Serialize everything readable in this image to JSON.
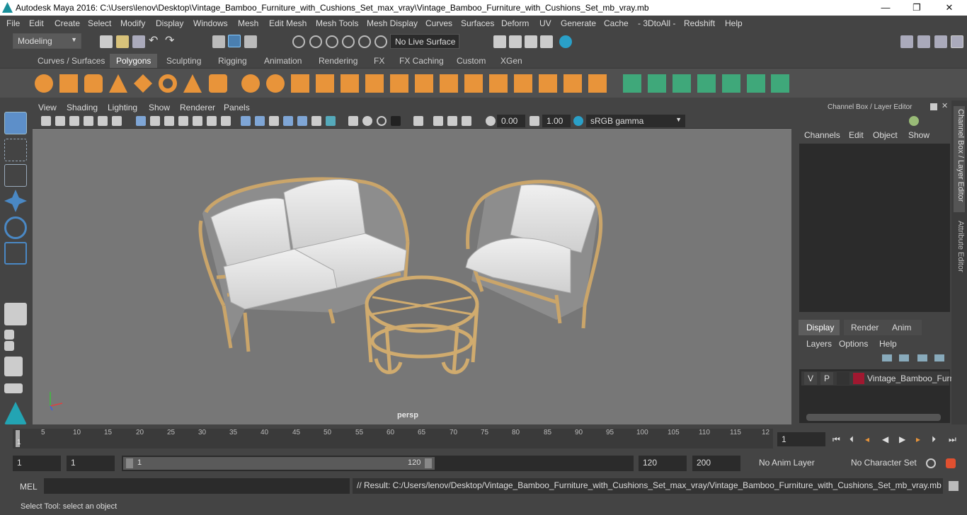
{
  "window": {
    "title": "Autodesk Maya 2016: C:\\Users\\lenov\\Desktop\\Vintage_Bamboo_Furniture_with_Cushions_Set_max_vray\\Vintage_Bamboo_Furniture_with_Cushions_Set_mb_vray.mb",
    "minimize": "—",
    "restore": "❐",
    "close": "✕"
  },
  "menubar": [
    "File",
    "Edit",
    "Create",
    "Select",
    "Modify",
    "Display",
    "Windows",
    "Mesh",
    "Edit Mesh",
    "Mesh Tools",
    "Mesh Display",
    "Curves",
    "Surfaces",
    "Deform",
    "UV",
    "Generate",
    "Cache",
    "- 3DtoAll -",
    "Redshift",
    "Help"
  ],
  "statusline": {
    "mode": "Modeling",
    "live_surface": "No Live Surface"
  },
  "shelf_tabs": [
    "Curves / Surfaces",
    "Polygons",
    "Sculpting",
    "Rigging",
    "Animation",
    "Rendering",
    "FX",
    "FX Caching",
    "Custom",
    "XGen"
  ],
  "active_shelf_tab": "Polygons",
  "viewport": {
    "menu": [
      "View",
      "Shading",
      "Lighting",
      "Show",
      "Renderer",
      "Panels"
    ],
    "exposure": "0.00",
    "gamma": "1.00",
    "color_space": "sRGB gamma",
    "camera_label": "persp"
  },
  "channel_box": {
    "header": "Channel Box / Layer Editor",
    "menu": [
      "Channels",
      "Edit",
      "Object",
      "Show"
    ]
  },
  "layer_editor": {
    "tabs": [
      "Display",
      "Render",
      "Anim"
    ],
    "active_tab": "Display",
    "menu": [
      "Layers",
      "Options",
      "Help"
    ],
    "layers": [
      {
        "v": "V",
        "p": "P",
        "name": "Vintage_Bamboo_Furn",
        "color": "#a01830"
      }
    ]
  },
  "side_tabs": [
    "Channel Box / Layer Editor",
    "Attribute Editor"
  ],
  "timeline": {
    "ticks": [
      "5",
      "10",
      "15",
      "20",
      "25",
      "30",
      "35",
      "40",
      "45",
      "50",
      "55",
      "60",
      "65",
      "70",
      "75",
      "80",
      "85",
      "90",
      "95",
      "100",
      "105",
      "110",
      "115",
      "12"
    ],
    "start_marker": "1",
    "current_frame": "1"
  },
  "range": {
    "start": "1",
    "playback_start": "1",
    "slider_start": "1",
    "slider_end": "120",
    "playback_end": "120",
    "end": "200",
    "anim_layer": "No Anim Layer",
    "character_set": "No Character Set"
  },
  "mel": {
    "label": "MEL",
    "result": "// Result: C:/Users/lenov/Desktop/Vintage_Bamboo_Furniture_with_Cushions_Set_max_vray/Vintage_Bamboo_Furniture_with_Cushions_Set_mb_vray.mb"
  },
  "help_line": "Select Tool: select an object",
  "colors": {
    "accent_orange": "#e8943a",
    "accent_green": "#3fa87a",
    "bamboo": "#d9b77a",
    "cushion": "#e6e6e6"
  }
}
